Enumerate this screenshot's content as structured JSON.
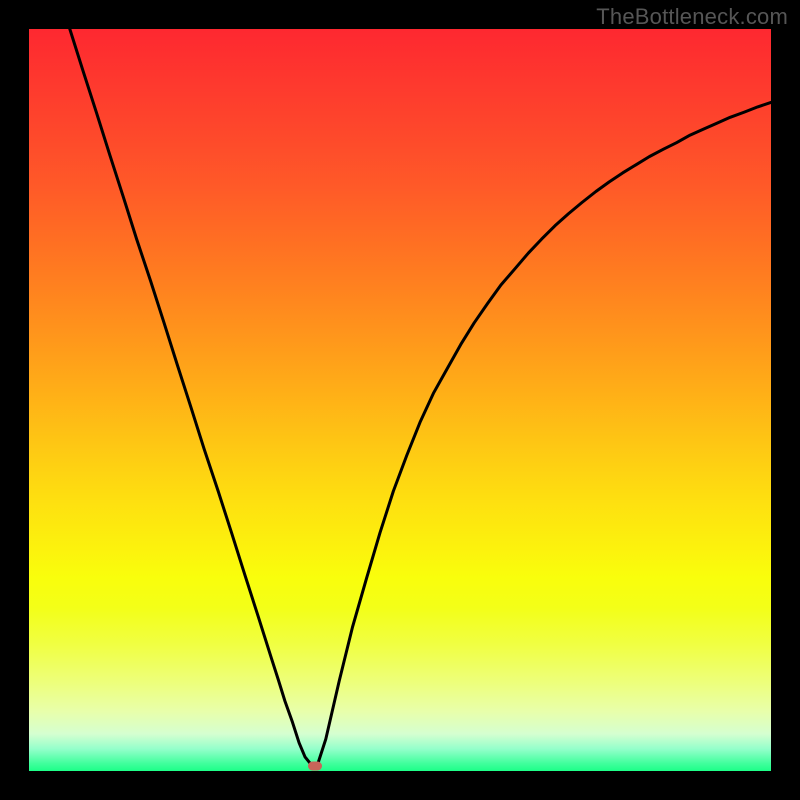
{
  "watermark": "TheBottleneck.com",
  "colors": {
    "marker": "#c96459",
    "curve": "#000000"
  },
  "marker": {
    "x_frac": 0.385,
    "y_frac": 0.993
  },
  "chart_data": {
    "type": "line",
    "title": "",
    "xlabel": "",
    "ylabel": "",
    "xlim": [
      0,
      1
    ],
    "ylim": [
      0,
      1
    ],
    "series": [
      {
        "name": "left-branch",
        "x": [
          0.055,
          0.073,
          0.091,
          0.109,
          0.127,
          0.145,
          0.164,
          0.182,
          0.2,
          0.218,
          0.236,
          0.255,
          0.273,
          0.291,
          0.309,
          0.327,
          0.336,
          0.345,
          0.355,
          0.364,
          0.372,
          0.38
        ],
        "y": [
          1.0,
          0.943,
          0.887,
          0.83,
          0.774,
          0.717,
          0.66,
          0.604,
          0.547,
          0.491,
          0.434,
          0.377,
          0.321,
          0.264,
          0.208,
          0.151,
          0.123,
          0.094,
          0.066,
          0.038,
          0.019,
          0.009
        ]
      },
      {
        "name": "right-branch",
        "x": [
          0.389,
          0.4,
          0.418,
          0.436,
          0.455,
          0.473,
          0.491,
          0.509,
          0.527,
          0.545,
          0.564,
          0.582,
          0.6,
          0.618,
          0.636,
          0.655,
          0.673,
          0.691,
          0.709,
          0.727,
          0.745,
          0.764,
          0.782,
          0.8,
          0.818,
          0.836,
          0.855,
          0.873,
          0.891,
          0.909,
          0.927,
          0.945,
          0.964,
          0.982,
          1.0
        ],
        "y": [
          0.009,
          0.043,
          0.121,
          0.194,
          0.26,
          0.321,
          0.377,
          0.425,
          0.47,
          0.509,
          0.543,
          0.575,
          0.604,
          0.63,
          0.655,
          0.677,
          0.698,
          0.717,
          0.735,
          0.751,
          0.766,
          0.781,
          0.794,
          0.806,
          0.817,
          0.828,
          0.838,
          0.847,
          0.857,
          0.865,
          0.873,
          0.881,
          0.888,
          0.895,
          0.901
        ]
      }
    ],
    "marker": {
      "x": 0.385,
      "y": 0.007
    }
  }
}
